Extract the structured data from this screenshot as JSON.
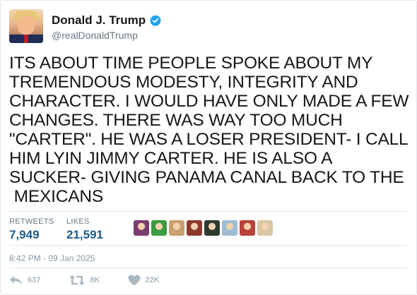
{
  "profile": {
    "name": "Donald J. Trump",
    "handle": "@realDonaldTrump",
    "verified_icon": "verified-badge-icon",
    "verified_color": "#1da1f2"
  },
  "tweet": {
    "text": "ITS ABOUT TIME PEOPLE SPOKE ABOUT MY\nTREMENDOUS MODESTY, INTEGRITY AND\nCHARACTER. I WOULD HAVE ONLY MADE A FEW\nCHANGES. THERE WAS WAY TOO MUCH\n\"CARTER\". HE WAS A LOSER PRESIDENT- I CALL\nHIM LYIN JIMMY CARTER. HE IS ALSO A\nSUCKER- GIVING PANAMA CANAL BACK TO THE\n MEXICANS"
  },
  "stats": {
    "retweets_label": "RETWEETS",
    "retweets_value": "7,949",
    "likes_label": "LIKES",
    "likes_value": "21,591"
  },
  "likers": [
    {
      "color": "#7a3d6e"
    },
    {
      "color": "#3a9b3f"
    },
    {
      "color": "#c9a070"
    },
    {
      "color": "#8e3b2c"
    },
    {
      "color": "#2e3a2f"
    },
    {
      "color": "#9fbcd3"
    },
    {
      "color": "#b8423a"
    },
    {
      "color": "#d8c8a2"
    }
  ],
  "timestamp": "8:42 PM - 09 Jan 2025",
  "actions": {
    "reply": {
      "icon": "reply-icon",
      "count": "637"
    },
    "retweet": {
      "icon": "retweet-icon",
      "count": "8K"
    },
    "like": {
      "icon": "heart-icon",
      "count": "22K"
    }
  },
  "colors": {
    "text": "#14171a",
    "secondary": "#657786",
    "stat_value": "#1c5b8d",
    "action": "#aab8c2"
  }
}
